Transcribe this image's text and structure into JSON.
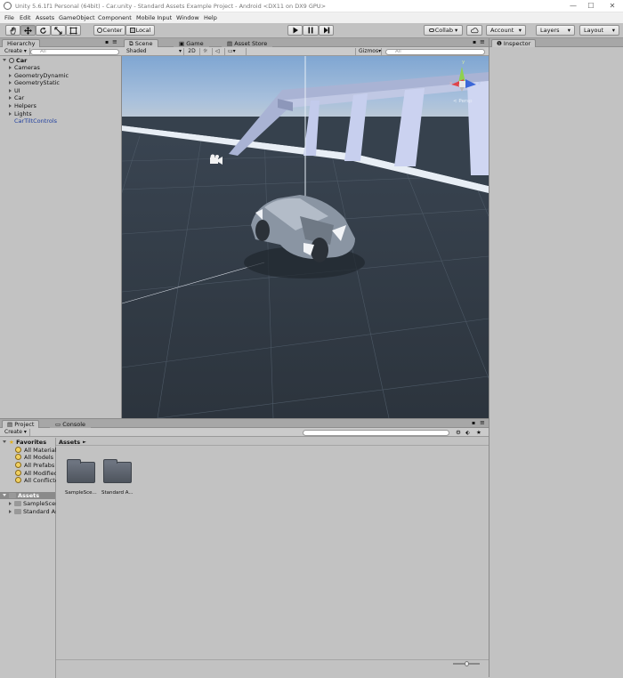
{
  "window": {
    "title": "Unity 5.6.1f1 Personal (64bit) - Car.unity - Standard Assets Example Project - Android <DX11 on DX9 GPU>",
    "minimize": "—",
    "maximize": "☐",
    "close": "✕"
  },
  "menu": [
    "File",
    "Edit",
    "Assets",
    "GameObject",
    "Component",
    "Mobile Input",
    "Window",
    "Help"
  ],
  "toolbar": {
    "pivot_label": "Center",
    "space_label": "Local",
    "collab_label": "Collab ▾",
    "account_label": "Account",
    "layers_label": "Layers",
    "layout_label": "Layout",
    "dropdown_caret": "▾"
  },
  "hierarchy": {
    "tab": "Hierarchy",
    "create": "Create ▾",
    "search_placeholder": "All",
    "scene_name": "Car",
    "items": [
      "Cameras",
      "GeometryDynamic",
      "GeometryStatic",
      "UI",
      "Car",
      "Helpers",
      "Lights",
      "CarTiltControls"
    ],
    "highlight_color": "#1f3f9f"
  },
  "scene": {
    "tabs": [
      "Scene",
      "Game",
      "Asset Store"
    ],
    "shading": "Shaded",
    "mode_2d": "2D",
    "gizmos": "Gizmos",
    "search_placeholder": "All",
    "persp_label": "< Persp",
    "axis": {
      "y": "y",
      "x": "x",
      "z": "z"
    }
  },
  "inspector": {
    "tab": "Inspector"
  },
  "project": {
    "tabs": [
      "Project",
      "Console"
    ],
    "create": "Create",
    "favorites_label": "Favorites",
    "favorites": [
      "All Materials",
      "All Models",
      "All Prefabs",
      "All Modified",
      "All Conflicted"
    ],
    "assets_label": "Assets",
    "asset_folders": [
      "SampleScenes",
      "Standard Assets"
    ],
    "breadcrumb": "Assets",
    "breadcrumb_sep": "►",
    "grid_items": [
      "SampleSce...",
      "Standard A..."
    ]
  }
}
